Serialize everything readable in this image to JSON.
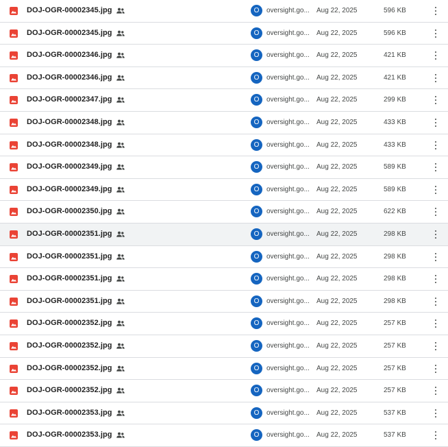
{
  "colors": {
    "image_icon": "#ea4335",
    "avatar": "#1565c0",
    "row_highlight": "#f1f3f4",
    "divider": "#dadce0"
  },
  "icons": {
    "file_type": "image-file-icon",
    "shared": "shared-people-icon",
    "more": "more-vert-icon"
  },
  "files": [
    {
      "name": "DOJ-OGR-00002345.jpg",
      "owner_initial": "O",
      "owner": "oversight.go...",
      "modified": "Aug 22, 2025",
      "size": "596 KB"
    },
    {
      "name": "DOJ-OGR-00002345.jpg",
      "owner_initial": "O",
      "owner": "oversight.go...",
      "modified": "Aug 22, 2025",
      "size": "596 KB"
    },
    {
      "name": "DOJ-OGR-00002346.jpg",
      "owner_initial": "O",
      "owner": "oversight.go...",
      "modified": "Aug 22, 2025",
      "size": "421 KB"
    },
    {
      "name": "DOJ-OGR-00002346.jpg",
      "owner_initial": "O",
      "owner": "oversight.go...",
      "modified": "Aug 22, 2025",
      "size": "421 KB"
    },
    {
      "name": "DOJ-OGR-00002347.jpg",
      "owner_initial": "O",
      "owner": "oversight.go...",
      "modified": "Aug 22, 2025",
      "size": "299 KB"
    },
    {
      "name": "DOJ-OGR-00002348.jpg",
      "owner_initial": "O",
      "owner": "oversight.go...",
      "modified": "Aug 22, 2025",
      "size": "433 KB"
    },
    {
      "name": "DOJ-OGR-00002348.jpg",
      "owner_initial": "O",
      "owner": "oversight.go...",
      "modified": "Aug 22, 2025",
      "size": "433 KB"
    },
    {
      "name": "DOJ-OGR-00002349.jpg",
      "owner_initial": "O",
      "owner": "oversight.go...",
      "modified": "Aug 22, 2025",
      "size": "589 KB"
    },
    {
      "name": "DOJ-OGR-00002349.jpg",
      "owner_initial": "O",
      "owner": "oversight.go...",
      "modified": "Aug 22, 2025",
      "size": "589 KB"
    },
    {
      "name": "DOJ-OGR-00002350.jpg",
      "owner_initial": "O",
      "owner": "oversight.go...",
      "modified": "Aug 22, 2025",
      "size": "622 KB"
    },
    {
      "name": "DOJ-OGR-00002351.jpg",
      "owner_initial": "O",
      "owner": "oversight.go...",
      "modified": "Aug 22, 2025",
      "size": "298 KB",
      "highlighted": true
    },
    {
      "name": "DOJ-OGR-00002351.jpg",
      "owner_initial": "O",
      "owner": "oversight.go...",
      "modified": "Aug 22, 2025",
      "size": "298 KB"
    },
    {
      "name": "DOJ-OGR-00002351.jpg",
      "owner_initial": "O",
      "owner": "oversight.go...",
      "modified": "Aug 22, 2025",
      "size": "298 KB"
    },
    {
      "name": "DOJ-OGR-00002351.jpg",
      "owner_initial": "O",
      "owner": "oversight.go...",
      "modified": "Aug 22, 2025",
      "size": "298 KB"
    },
    {
      "name": "DOJ-OGR-00002352.jpg",
      "owner_initial": "O",
      "owner": "oversight.go...",
      "modified": "Aug 22, 2025",
      "size": "257 KB"
    },
    {
      "name": "DOJ-OGR-00002352.jpg",
      "owner_initial": "O",
      "owner": "oversight.go...",
      "modified": "Aug 22, 2025",
      "size": "257 KB"
    },
    {
      "name": "DOJ-OGR-00002352.jpg",
      "owner_initial": "O",
      "owner": "oversight.go...",
      "modified": "Aug 22, 2025",
      "size": "257 KB"
    },
    {
      "name": "DOJ-OGR-00002352.jpg",
      "owner_initial": "O",
      "owner": "oversight.go...",
      "modified": "Aug 22, 2025",
      "size": "257 KB"
    },
    {
      "name": "DOJ-OGR-00002353.jpg",
      "owner_initial": "O",
      "owner": "oversight.go...",
      "modified": "Aug 22, 2025",
      "size": "537 KB"
    },
    {
      "name": "DOJ-OGR-00002353.jpg",
      "owner_initial": "O",
      "owner": "oversight.go...",
      "modified": "Aug 22, 2025",
      "size": "537 KB"
    }
  ]
}
